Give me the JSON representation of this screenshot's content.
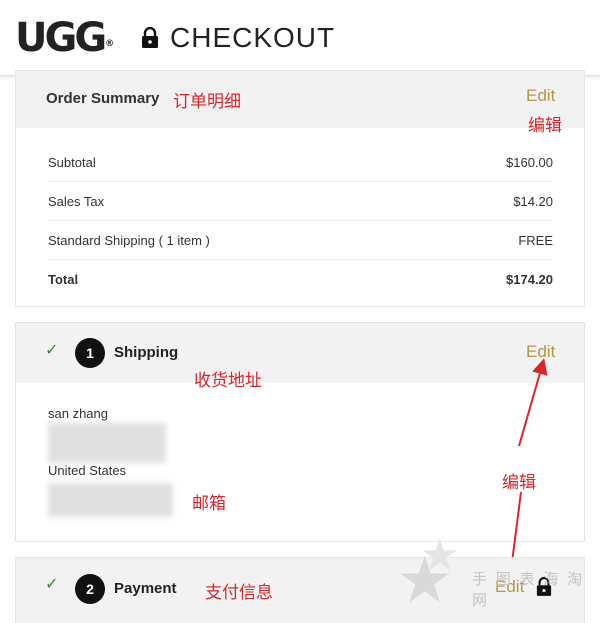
{
  "header": {
    "logo_text": "UGG",
    "logo_mark": "®",
    "title": "CHECKOUT",
    "lock_icon": "lock-icon"
  },
  "order_summary": {
    "heading": "Order Summary",
    "annotation": "订单明细",
    "edit_label": "Edit",
    "edit_annotation": "编辑",
    "rows": [
      {
        "label": "Subtotal",
        "value": "$160.00"
      },
      {
        "label": "Sales Tax",
        "value": "$14.20"
      },
      {
        "label": "Standard Shipping ( 1 item )",
        "value": "FREE"
      },
      {
        "label": "Total",
        "value": "$174.20"
      }
    ]
  },
  "shipping": {
    "step_number": "1",
    "heading": "Shipping",
    "annotation": "收货地址",
    "edit_label": "Edit",
    "name": "san zhang",
    "country": "United States",
    "email_annotation": "邮箱",
    "edit_annotation": "编辑"
  },
  "payment": {
    "step_number": "2",
    "heading": "Payment",
    "annotation": "支付信息",
    "edit_label": "Edit"
  },
  "watermark": {
    "text": "手 图 表 海 淘 网"
  },
  "colors": {
    "edit": "#b5974a",
    "annotation": "#d9262c",
    "check": "#3a8a3a",
    "header_bg": "#f2f2f2"
  }
}
